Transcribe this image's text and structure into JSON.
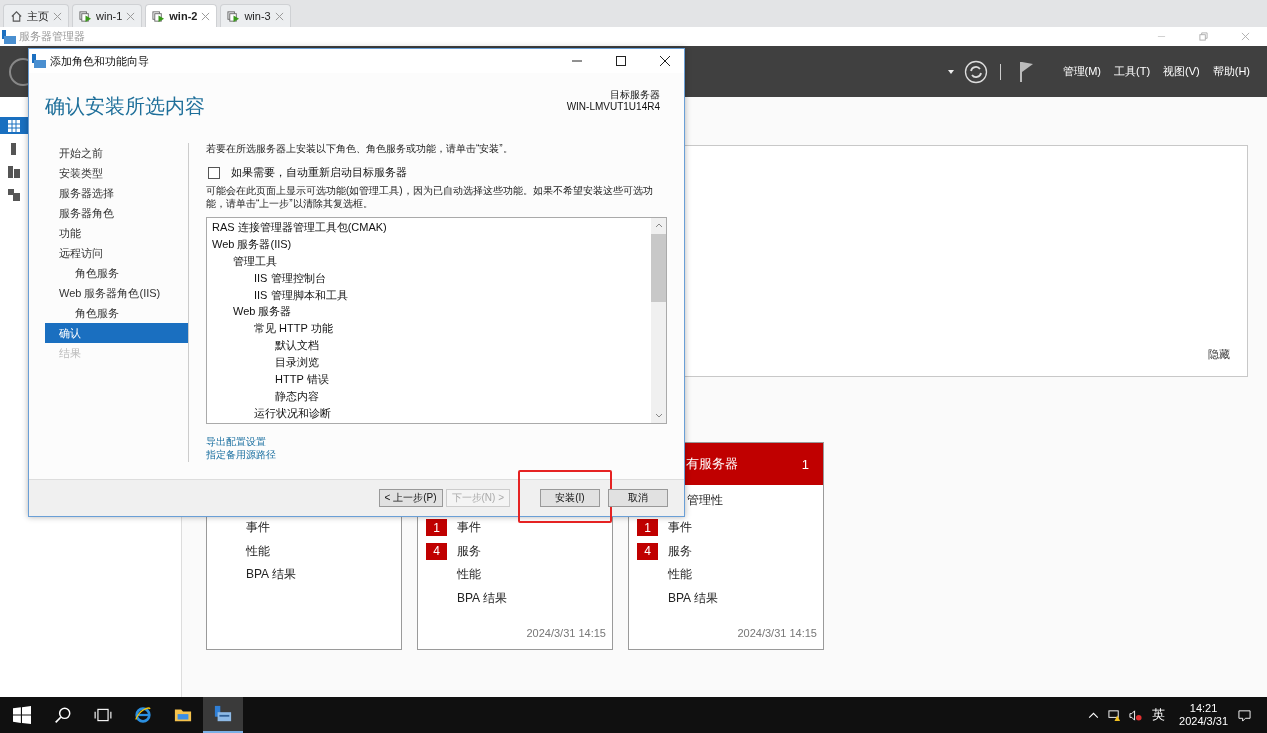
{
  "browser_tabs": [
    {
      "kind": "home",
      "label": "主页",
      "selected": false
    },
    {
      "kind": "vm",
      "label": "win-1",
      "selected": false
    },
    {
      "kind": "vm",
      "label": "win-2",
      "selected": true
    },
    {
      "kind": "vm",
      "label": "win-3",
      "selected": false
    }
  ],
  "app": {
    "title": "服务器管理器",
    "menus": [
      "管理(M)",
      "工具(T)",
      "视图(V)",
      "帮助(H)"
    ]
  },
  "sidebar": {
    "items": [
      {
        "kind": "dashboard",
        "selected": true
      },
      {
        "kind": "local",
        "selected": false
      },
      {
        "kind": "all",
        "selected": false
      },
      {
        "kind": "roles",
        "selected": false
      }
    ]
  },
  "welcome_panel": {
    "hide_link": "隐藏"
  },
  "tiles": [
    {
      "rows": [
        {
          "label": "事件"
        },
        {
          "label": "性能"
        },
        {
          "label": "BPA 结果"
        }
      ]
    },
    {
      "rows": [
        {
          "label": "事件",
          "badge": "1"
        },
        {
          "label": "服务",
          "badge": "4"
        },
        {
          "label": "性能"
        },
        {
          "label": "BPA 结果"
        }
      ],
      "timestamp": "2024/3/31 14:15"
    },
    {
      "title": "有服务器",
      "count": "1",
      "manageability": "管理性",
      "rows": [
        {
          "label": "事件",
          "badge": "1"
        },
        {
          "label": "服务",
          "badge": "4"
        },
        {
          "label": "性能"
        },
        {
          "label": "BPA 结果"
        }
      ],
      "timestamp": "2024/3/31 14:15"
    }
  ],
  "dialog": {
    "title": "添加角色和功能向导",
    "heading": "确认安装所选内容",
    "target_label": "目标服务器",
    "target_server": "WIN-LMVUT1U14R4",
    "nav": [
      {
        "label": "开始之前",
        "selected": false,
        "disabled": false
      },
      {
        "label": "安装类型",
        "selected": false,
        "disabled": false
      },
      {
        "label": "服务器选择",
        "selected": false,
        "disabled": false
      },
      {
        "label": "服务器角色",
        "selected": false,
        "disabled": false
      },
      {
        "label": "功能",
        "selected": false,
        "disabled": false
      },
      {
        "label": "远程访问",
        "selected": false,
        "disabled": false,
        "children": [
          {
            "label": "角色服务",
            "selected": false,
            "disabled": false
          }
        ]
      },
      {
        "label": "Web 服务器角色(IIS)",
        "selected": false,
        "disabled": false,
        "children": [
          {
            "label": "角色服务",
            "selected": false,
            "disabled": false
          }
        ]
      },
      {
        "label": "确认",
        "selected": true,
        "disabled": false
      },
      {
        "label": "结果",
        "selected": false,
        "disabled": true
      }
    ],
    "intro": "若要在所选服务器上安装以下角色、角色服务或功能，请单击“安装”。",
    "restart_option": {
      "label": "如果需要，自动重新启动目标服务器",
      "checked": false
    },
    "note": "可能会在此页面上显示可选功能(如管理工具)，因为已自动选择这些功能。如果不希望安装这些可选功能，请单击“上一步”以清除其复选框。",
    "items": [
      {
        "label": "RAS 连接管理器管理工具包(CMAK)"
      },
      {
        "label": "Web 服务器(IIS)",
        "children": [
          {
            "label": "管理工具",
            "children": [
              {
                "label": "IIS 管理控制台"
              },
              {
                "label": "IIS 管理脚本和工具"
              }
            ]
          },
          {
            "label": "Web 服务器",
            "children": [
              {
                "label": "常见 HTTP 功能",
                "children": [
                  {
                    "label": "默认文档"
                  },
                  {
                    "label": "目录浏览"
                  },
                  {
                    "label": "HTTP 错误"
                  },
                  {
                    "label": "静态内容"
                  }
                ]
              },
              {
                "label": "运行状况和诊断"
              }
            ]
          }
        ]
      }
    ],
    "links": [
      "导出配置设置",
      "指定备用源路径"
    ],
    "buttons": [
      {
        "label": "< 上一步(P)",
        "disabled": false,
        "highlighted": false
      },
      {
        "label": "下一步(N) >",
        "disabled": true,
        "highlighted": false
      },
      {
        "label": "安装(I)",
        "disabled": false,
        "highlighted": true
      },
      {
        "label": "取消",
        "disabled": false,
        "highlighted": false
      }
    ]
  },
  "taskbar": {
    "apps": [
      {
        "kind": "start",
        "selected": false
      },
      {
        "kind": "search",
        "selected": false
      },
      {
        "kind": "taskview",
        "selected": false
      },
      {
        "kind": "browser",
        "selected": false
      },
      {
        "kind": "folder",
        "selected": false
      },
      {
        "kind": "servermanager",
        "selected": true
      }
    ],
    "ime": "英",
    "time": "14:21",
    "date": "2024/3/31"
  }
}
